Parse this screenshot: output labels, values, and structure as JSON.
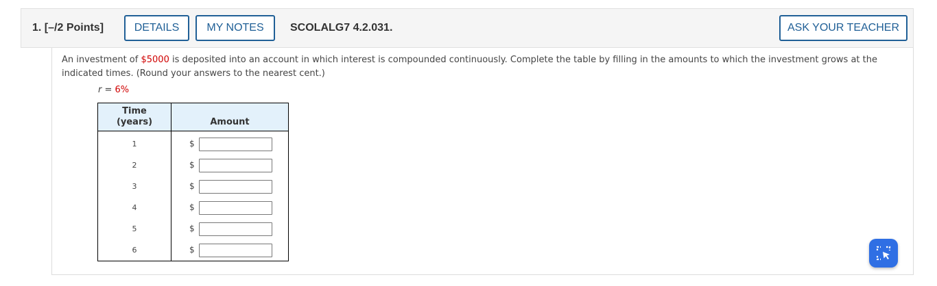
{
  "header": {
    "question_number": "1.",
    "points": "[–/2 Points]",
    "details_label": "DETAILS",
    "notes_label": "MY NOTES",
    "problem_code": "SCOLALG7 4.2.031.",
    "ask_label": "ASK YOUR TEACHER"
  },
  "problem": {
    "text_before": "An investment of ",
    "amount": "$5000",
    "text_after": " is deposited into an account in which interest is compounded continuously. Complete the table by filling in the amounts to which the investment grows at the indicated times. (Round your answers to the nearest cent.)",
    "rate_var": "r",
    "rate_eq": " = ",
    "rate_value": "6%"
  },
  "table": {
    "header_time_line1": "Time",
    "header_time_line2": "(years)",
    "header_amount": "Amount",
    "currency": "$",
    "rows": [
      {
        "time": "1",
        "value": ""
      },
      {
        "time": "2",
        "value": ""
      },
      {
        "time": "3",
        "value": ""
      },
      {
        "time": "4",
        "value": ""
      },
      {
        "time": "5",
        "value": ""
      },
      {
        "time": "6",
        "value": ""
      }
    ]
  },
  "floating_tool": {
    "icon": "screenshot-select-icon",
    "color": "#2f6fe4"
  },
  "colors": {
    "accent": "#1f5f96",
    "highlight": "#d00000",
    "table_header": "#e3f1fb"
  }
}
